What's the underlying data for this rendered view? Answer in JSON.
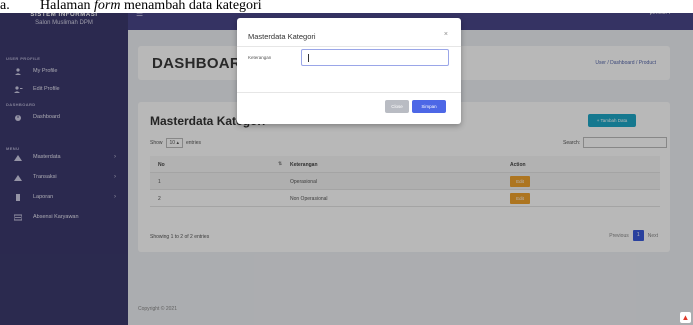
{
  "caption": {
    "prefix": "a.",
    "text_before": "Halaman ",
    "text_italic": "form",
    "text_after": " menambah data kategori"
  },
  "sidebar": {
    "brand_line1": "SISTEM INFORMASI",
    "brand_line2": "Salon Muslimah DPM",
    "sections": {
      "user_profile": "USER PROFILE",
      "dashboard": "DASHBOARD",
      "menu": "MENU"
    },
    "items": [
      {
        "label": "My Profile",
        "icon": "user-icon"
      },
      {
        "label": "Edit Profile",
        "icon": "user-edit-icon"
      },
      {
        "label": "Dashboard",
        "icon": "dashboard-icon"
      },
      {
        "label": "Masterdata",
        "icon": "masterdata-icon",
        "chevron": "›"
      },
      {
        "label": "Transaksi",
        "icon": "transaksi-icon",
        "chevron": "›"
      },
      {
        "label": "Laporan",
        "icon": "laporan-icon",
        "chevron": "›"
      },
      {
        "label": "Absensi Karyawan",
        "icon": "absensi-icon"
      }
    ]
  },
  "topbar": {
    "menu_icon": "☰",
    "user": "pemilik",
    "user_caret": "▾"
  },
  "header": {
    "title": "DASHBOARD",
    "breadcrumb": "User / Dashboard / Product"
  },
  "card": {
    "title": "Masterdata Kategori",
    "add_button": "+ Tambah Data",
    "show_label": "Show",
    "show_value": "10 ▴",
    "entries_label": "entries",
    "search_label": "Search:",
    "columns": [
      "No",
      "Keterangan",
      "Action"
    ],
    "sort_icon": "⇅",
    "rows": [
      {
        "no": "1",
        "keterangan": "Operasional",
        "action": "Edit"
      },
      {
        "no": "2",
        "keterangan": "Non Operasional",
        "action": "Edit"
      }
    ],
    "info": "Showing 1 to 2 of 2 entries",
    "pagination": {
      "previous": "Previous",
      "page": "1",
      "next": "Next"
    }
  },
  "footer": "Copyright © 2021",
  "modal": {
    "title": "Masterdata Kategori",
    "close_icon": "×",
    "field_label": "Keterangan",
    "field_value": "",
    "close_button": "Close",
    "save_button": "Simpan"
  },
  "colors": {
    "sidebar": "#3c3a6e",
    "topbar": "#4a478a",
    "primary": "#4d67e6",
    "info": "#1ea7c6",
    "warning": "#f0a22d"
  }
}
